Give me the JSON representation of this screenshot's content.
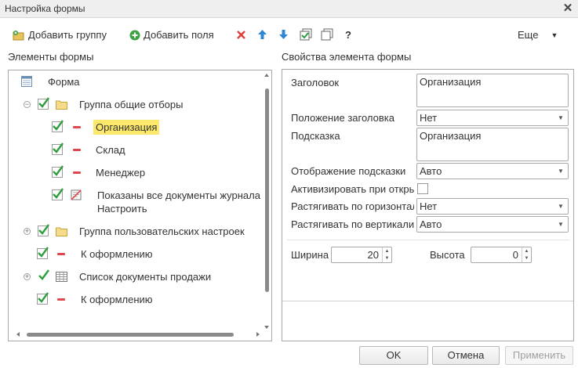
{
  "window": {
    "title": "Настройка формы",
    "close_icon": "close-icon"
  },
  "toolbar": {
    "add_group": "Добавить группу",
    "add_fields": "Добавить поля",
    "help": "?",
    "more": "Еще",
    "more_arrow": "▼"
  },
  "left": {
    "title": "Элементы формы",
    "tree": [
      {
        "label": "Форма"
      },
      {
        "label": "Группа общие отборы",
        "expander": "−"
      },
      {
        "label": "Организация"
      },
      {
        "label": "Склад"
      },
      {
        "label": "Менеджер"
      },
      {
        "label": "Показаны все документы журнала",
        "sub": "Настроить"
      },
      {
        "label": "Группа пользовательских настроек",
        "expander": "+"
      },
      {
        "label": "К оформлению"
      },
      {
        "label": "Список документы продажи",
        "expander": "+"
      },
      {
        "label": "К оформлению"
      }
    ]
  },
  "right": {
    "title": "Свойства элемента формы",
    "props": {
      "header_label": "Заголовок",
      "header_value": "Организация",
      "header_pos_label": "Положение заголовка",
      "header_pos_value": "Нет",
      "hint_label": "Подсказка",
      "hint_value": "Организация",
      "hint_display_label": "Отображение подсказки",
      "hint_display_value": "Авто",
      "activate_label": "Активизировать при откры",
      "hstretch_label": "Растягивать по горизонтал",
      "hstretch_value": "Нет",
      "vstretch_label": "Растягивать по вертикали",
      "vstretch_value": "Авто",
      "width_label": "Ширина",
      "width_value": "20",
      "height_label": "Высота",
      "height_value": "0"
    }
  },
  "footer": {
    "ok": "OK",
    "cancel": "Отмена",
    "apply": "Применить"
  },
  "colors": {
    "check": "#2e9e3e",
    "dash": "#e0474c",
    "selection": "#fce86a",
    "up_arrow": "#2f86d3",
    "delete": "#e23b3b"
  }
}
